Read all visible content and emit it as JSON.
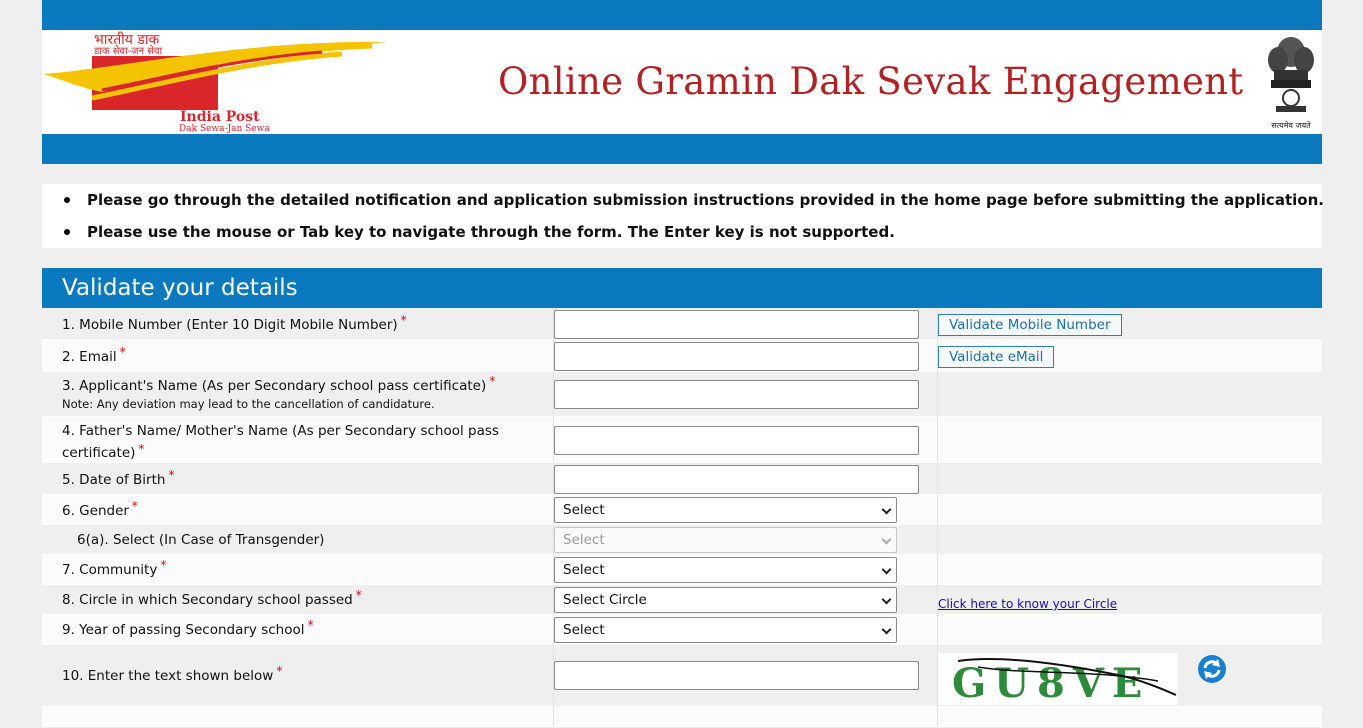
{
  "header": {
    "logo_hindi": "भारतीय डाक",
    "logo_hindi_tagline": "डाक सेवा-जन सेवा",
    "logo_name": "India Post",
    "logo_tagline": "Dak Sewa-Jan Sewa",
    "title": "Online Gramin Dak Sevak Engagement",
    "emblem_motto": "सत्यमेव जयते"
  },
  "notice": {
    "items": [
      "Please go through the detailed notification and application submission instructions provided in the home page before submitting the application.",
      "Please use the mouse or Tab key to navigate through the form. The Enter key is not supported."
    ]
  },
  "form": {
    "heading": "Validate your details",
    "required_mark": "*",
    "fields": [
      {
        "label": "1. Mobile Number (Enter 10 Digit Mobile Number)",
        "value": "",
        "button": "Validate Mobile Number"
      },
      {
        "label": "2. Email",
        "value": "",
        "button": "Validate eMail"
      },
      {
        "label": "3. Applicant's Name (As per Secondary school pass certificate)",
        "note": "Note: Any deviation may lead to the cancellation of candidature.",
        "value": ""
      },
      {
        "label_line1": "4. Father's Name/ Mother's Name (As per Secondary school pass",
        "label_line2": "certificate)",
        "value": ""
      },
      {
        "label": "5. Date of Birth",
        "value": ""
      },
      {
        "label": "6. Gender",
        "selected": "Select"
      },
      {
        "label": "6(a). Select (In Case of Transgender)",
        "selected": "Select"
      },
      {
        "label": "7. Community",
        "selected": "Select"
      },
      {
        "label": "8. Circle in which Secondary school passed",
        "selected": "Select Circle",
        "link": "Click here to know your Circle"
      },
      {
        "label": "9. Year of passing Secondary school",
        "selected": "Select"
      },
      {
        "label": "10. Enter the text shown below",
        "value": "",
        "captcha_text": "GU8VE"
      }
    ]
  },
  "colors": {
    "brand_blue": "#0b79bf",
    "title_red": "#b22222",
    "required_red": "#ee0000"
  },
  "icons": [
    "india-post-logo",
    "national-emblem-icon",
    "captcha-image",
    "refresh-icon",
    "chevron-down-icon"
  ]
}
